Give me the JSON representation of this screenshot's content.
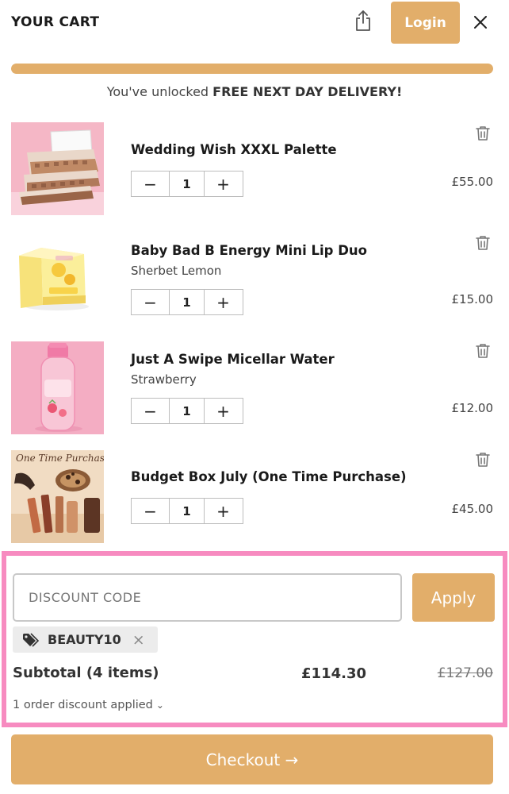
{
  "header": {
    "title": "YOUR CART",
    "share_icon": "share-icon",
    "login_label": "Login",
    "close_icon": "close-icon",
    "accent_color": "#e2ae6a"
  },
  "delivery": {
    "progress_fraction": 1.0,
    "message_prefix": "You've unlocked ",
    "message_bold": "FREE NEXT DAY DELIVERY!"
  },
  "items": [
    {
      "name": "Wedding Wish XXXL Palette",
      "variant": "",
      "quantity": "1",
      "price": "£55.00"
    },
    {
      "name": "Baby Bad B Energy Mini Lip Duo",
      "variant": "Sherbet Lemon",
      "quantity": "1",
      "price": "£15.00"
    },
    {
      "name": "Just A Swipe Micellar Water",
      "variant": "Strawberry",
      "quantity": "1",
      "price": "£12.00"
    },
    {
      "name": "Budget Box July (One Time Purchase)",
      "variant": "",
      "quantity": "1",
      "price": "£45.00"
    }
  ],
  "thumbnail_text": "One Time Purchase",
  "discount": {
    "placeholder": "DISCOUNT CODE",
    "apply_label": "Apply",
    "applied_code": "BEAUTY10",
    "remove_symbol": "×",
    "highlight_color": "#f78bc0"
  },
  "summary": {
    "subtotal_label": "Subtotal (4 items)",
    "subtotal_price": "£114.30",
    "original_price": "£127.00",
    "discount_note": "1 order discount applied"
  },
  "checkout": {
    "label": "Checkout →"
  }
}
